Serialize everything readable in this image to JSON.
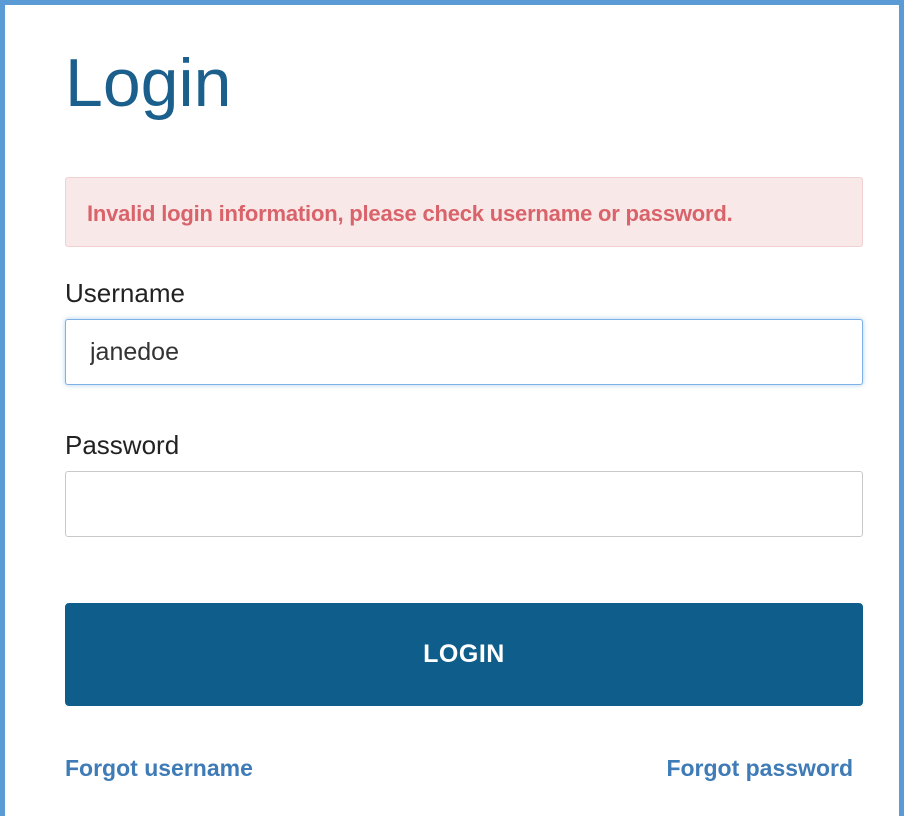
{
  "page": {
    "title": "Login"
  },
  "alert": {
    "message": "Invalid login information, please check username or password."
  },
  "form": {
    "username_label": "Username",
    "username_value": "janedoe",
    "password_label": "Password",
    "password_value": "",
    "login_label": "LOGIN"
  },
  "links": {
    "forgot_username": "Forgot username",
    "forgot_password": "Forgot password"
  },
  "colors": {
    "title": "#1b5f8c",
    "alert_background": "#f9e8e8",
    "alert_text": "#d9636a",
    "button_background": "#0f5d8a",
    "link": "#3f7bb6",
    "frame_border": "#5b9bd5"
  }
}
